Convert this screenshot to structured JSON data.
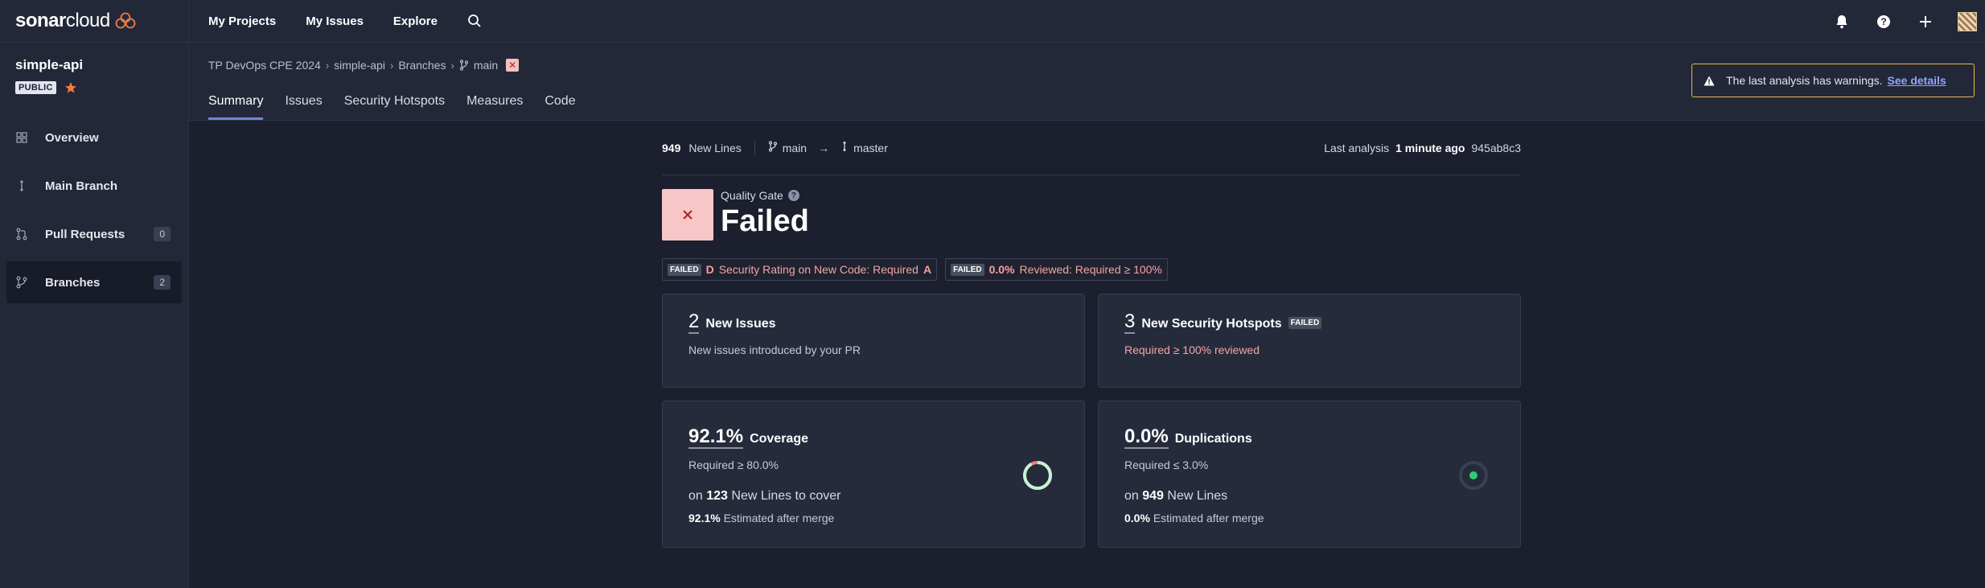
{
  "app": {
    "logo": {
      "part1": "sonar",
      "part2": "cloud"
    },
    "colors": {
      "accent": "#6f86d6",
      "failed_bg": "#f7c7c7",
      "failed_text": "#b32626",
      "warning_border": "#e7b84b",
      "success": "#2ecc71"
    }
  },
  "sidebar": {
    "project_name": "simple-api",
    "visibility": "PUBLIC",
    "items": [
      {
        "label": "Overview",
        "icon": "overview-icon"
      },
      {
        "label": "Main Branch",
        "icon": "main-branch-icon"
      },
      {
        "label": "Pull Requests",
        "icon": "pull-request-icon",
        "count": "0"
      },
      {
        "label": "Branches",
        "icon": "branch-icon",
        "count": "2",
        "active": true
      }
    ]
  },
  "topbar": {
    "links": [
      "My Projects",
      "My Issues",
      "Explore"
    ],
    "icons": [
      "search-icon",
      "bell-icon",
      "help-icon",
      "plus-icon",
      "avatar"
    ]
  },
  "header": {
    "breadcrumb": [
      "TP DevOps CPE 2024",
      "simple-api",
      "Branches",
      "main"
    ],
    "tabs": [
      "Summary",
      "Issues",
      "Security Hotspots",
      "Measures",
      "Code"
    ],
    "active_tab": "Summary",
    "warning": {
      "text": "The last analysis has warnings.",
      "link": "See details"
    }
  },
  "summary": {
    "new_lines_count": "949",
    "new_lines_label": "New Lines",
    "branch_from": "main",
    "arrow": "→",
    "branch_to": "master",
    "last_analysis_label": "Last analysis",
    "last_analysis_time": "1 minute ago",
    "commit": "945ab8c3"
  },
  "quality_gate": {
    "label": "Quality Gate",
    "status": "Failed",
    "conditions": [
      {
        "tag": "FAILED",
        "value": "D",
        "text": "Security Rating on New Code: Required",
        "required": "A"
      },
      {
        "tag": "FAILED",
        "value": "0.0%",
        "text": "Reviewed: Required ≥ 100%",
        "required": ""
      }
    ]
  },
  "cards": {
    "issues": {
      "count": "2",
      "label": "New Issues",
      "sub": "New issues introduced by your PR"
    },
    "hotspots": {
      "count": "3",
      "label": "New Security Hotspots",
      "tag": "FAILED",
      "sub": "Required ≥ 100% reviewed"
    },
    "coverage": {
      "value": "92.1%",
      "label": "Coverage",
      "required": "Required ≥ 80.0%",
      "on_prefix": "on",
      "lines": "123",
      "lines_suffix": "New Lines to cover",
      "estimate_value": "92.1%",
      "estimate_text": "Estimated after merge",
      "gauge_fraction": 0.921
    },
    "duplications": {
      "value": "0.0%",
      "label": "Duplications",
      "required": "Required ≤ 3.0%",
      "on_prefix": "on",
      "lines": "949",
      "lines_suffix": "New Lines",
      "estimate_value": "0.0%",
      "estimate_text": "Estimated after merge",
      "gauge_fraction": 0.0
    }
  }
}
